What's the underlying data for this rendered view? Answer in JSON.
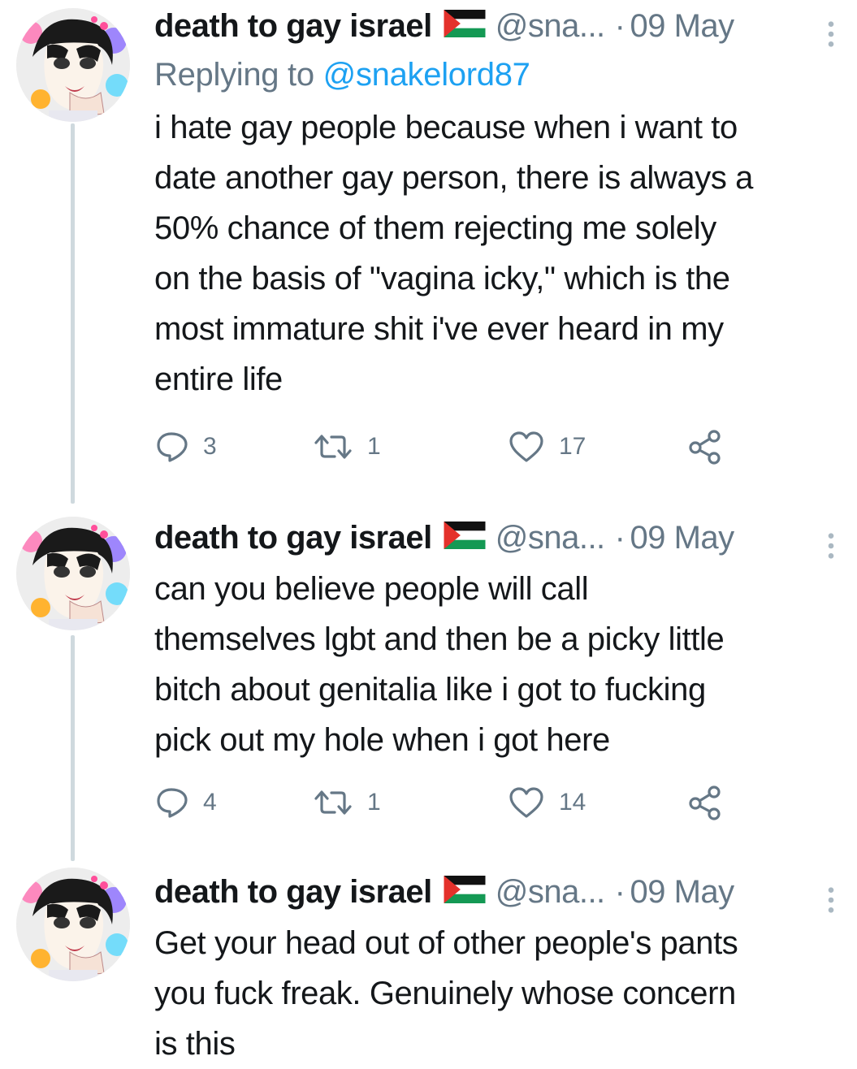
{
  "tweets": [
    {
      "name": "death to gay israel",
      "flag_icon": "palestine-flag-icon",
      "handle": "@sna...",
      "separator": "·",
      "date": "09 May",
      "reply_prefix": "Replying to",
      "reply_mention": "@snakelord87",
      "text": "i hate gay people because when i want to\ndate another gay person, there is always a\n50% chance of them rejecting me solely\non the basis of \"vagina icky,\" which is the\nmost immature shit i've ever heard in my\nentire life",
      "replies": "3",
      "retweets": "1",
      "likes": "17"
    },
    {
      "name": "death to gay israel",
      "flag_icon": "palestine-flag-icon",
      "handle": "@sna...",
      "separator": "·",
      "date": "09 May",
      "text": "can you believe people will call\nthemselves lgbt and then be a picky little\nbitch about genitalia like i got to fucking\npick out my hole when i got here",
      "replies": "4",
      "retweets": "1",
      "likes": "14"
    },
    {
      "name": "death to gay israel",
      "flag_icon": "palestine-flag-icon",
      "handle": "@sna...",
      "separator": "·",
      "date": "09 May",
      "text": "Get your head out of other people's pants\nyou fuck freak. Genuinely whose concern\nis this"
    }
  ],
  "colors": {
    "text": "#14171a",
    "secondary": "#657786",
    "link": "#1da1f2",
    "thread_line": "#cfd9de"
  }
}
